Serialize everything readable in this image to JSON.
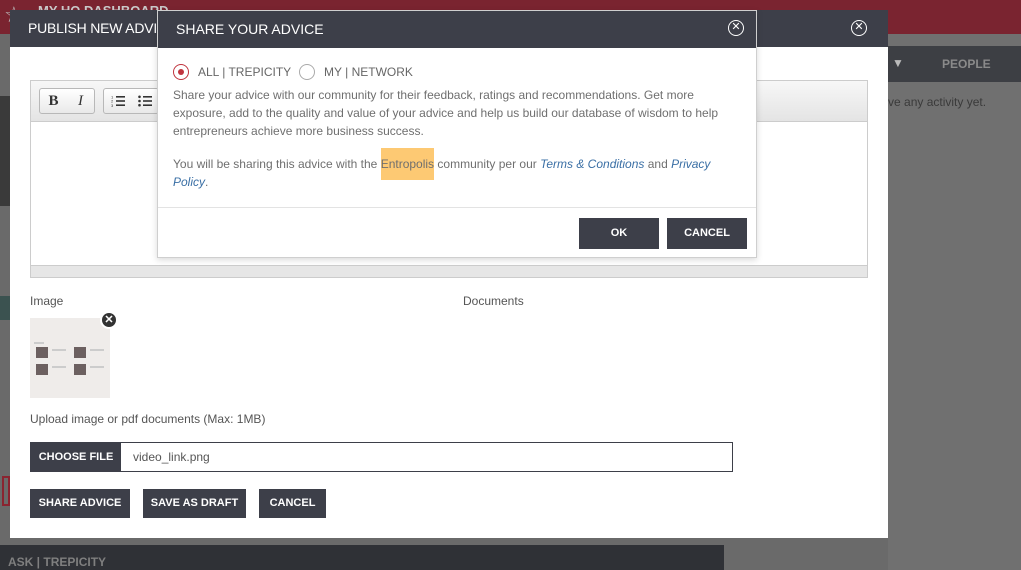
{
  "background": {
    "dashboard_title": "MY HQ DASHBOARD",
    "people_tab": "PEOPLE",
    "activity_text": "t have any activity yet.",
    "bottom_section": "ASK | TREPICITY"
  },
  "publish_modal": {
    "title": "PUBLISH NEW ADVICE",
    "toolbar": {
      "bold": "B",
      "italic": "I",
      "ordered_list": "ordered-list-icon",
      "bullet_list": "bullet-list-icon"
    },
    "image_label": "Image",
    "documents_label": "Documents",
    "upload_hint": "Upload image or pdf documents (Max: 1MB)",
    "choose_file_label": "CHOOSE FILE",
    "file_name": "video_link.png",
    "buttons": {
      "share": "SHARE ADVICE",
      "draft": "SAVE AS DRAFT",
      "cancel": "CANCEL"
    }
  },
  "share_dialog": {
    "title": "SHARE YOUR ADVICE",
    "options": [
      {
        "label": "ALL | TREPICITY",
        "selected": true
      },
      {
        "label": "MY | NETWORK",
        "selected": false
      }
    ],
    "description": "Share your advice with our community for their feedback, ratings and recommendations. Get more exposure, add to the quality and value of your advice and help us build our database of wisdom to help entrepreneurs achieve more business success.",
    "notice_before": "You will be sharing this advice with the ",
    "notice_highlight": "Entropolis",
    "notice_middle": " community per our ",
    "terms_link": "Terms & Conditions",
    "notice_and": " and ",
    "privacy_link": "Privacy Policy",
    "notice_end": ".",
    "ok_label": "OK",
    "cancel_label": "CANCEL"
  },
  "colors": {
    "header": "#3d3f49",
    "accent_red": "#c0343e",
    "highlight": "#fdc973",
    "link": "#3a6fa5"
  }
}
